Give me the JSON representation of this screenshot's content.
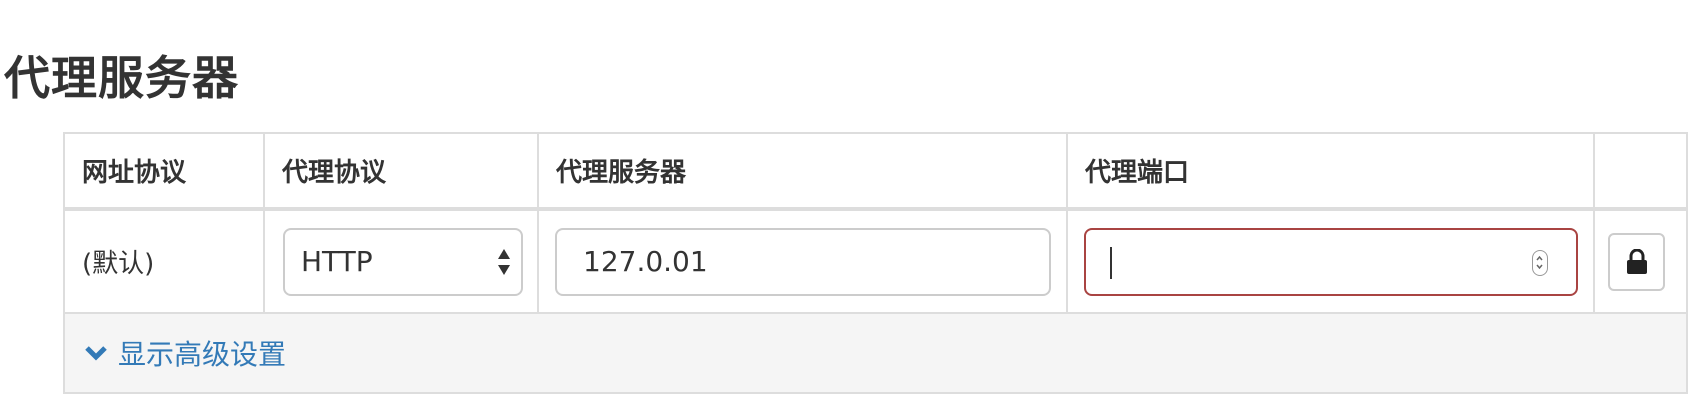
{
  "section": {
    "title": "代理服务器"
  },
  "table": {
    "headers": [
      "网址协议",
      "代理协议",
      "代理服务器",
      "代理端口",
      ""
    ],
    "row": {
      "url_scheme": "(默认)",
      "proxy_protocol": {
        "selected": "HTTP",
        "options": [
          "HTTP"
        ]
      },
      "proxy_server": {
        "value": "127.0.01"
      },
      "proxy_port": {
        "value": "",
        "state": "invalid"
      },
      "lock_icon": "lock-icon"
    }
  },
  "advanced": {
    "label": "显示高级设置",
    "icon": "chevron-down-icon"
  },
  "colors": {
    "link": "#337ab7",
    "error_border": "#a94442",
    "border": "#dddddd",
    "advanced_bg": "#f5f5f5"
  }
}
